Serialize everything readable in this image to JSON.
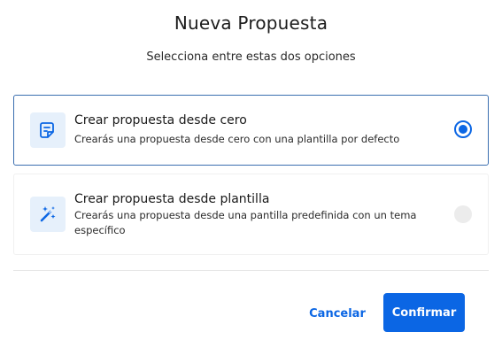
{
  "dialog": {
    "title": "Nueva Propuesta",
    "subtitle": "Selecciona entre estas dos opciones"
  },
  "options": [
    {
      "title": "Crear propuesta desde cero",
      "description": "Crearás una propuesta desde cero con una plantilla por defecto",
      "icon": "document-edit-icon",
      "selected": true
    },
    {
      "title": "Crear propuesta desde plantilla",
      "description": "Crearás una propuesta desde una pantilla predefinida con un tema específico",
      "icon": "magic-wand-icon",
      "selected": false
    }
  ],
  "actions": {
    "cancel_label": "Cancelar",
    "confirm_label": "Confirmar"
  },
  "colors": {
    "accent": "#0b66e4",
    "selected_border": "#3b6fb0",
    "icon_bg": "#e6f0fb"
  }
}
